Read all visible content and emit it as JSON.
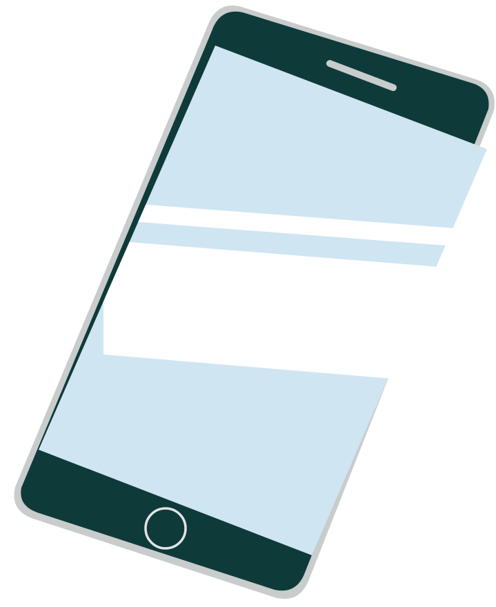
{
  "illustration": {
    "subject": "smartphone",
    "colors": {
      "background": "#ffffff",
      "body": "#0e3a3a",
      "body_edge": "#c9cccc",
      "screen": "#cfe5f2",
      "screen_highlight": "#ffffff",
      "speaker": "#c9cccc",
      "home_button_ring": "#e2e4e4"
    },
    "icons": {
      "phone": "smartphone-icon",
      "speaker": "speaker-grille-icon",
      "home": "home-button-icon"
    }
  }
}
